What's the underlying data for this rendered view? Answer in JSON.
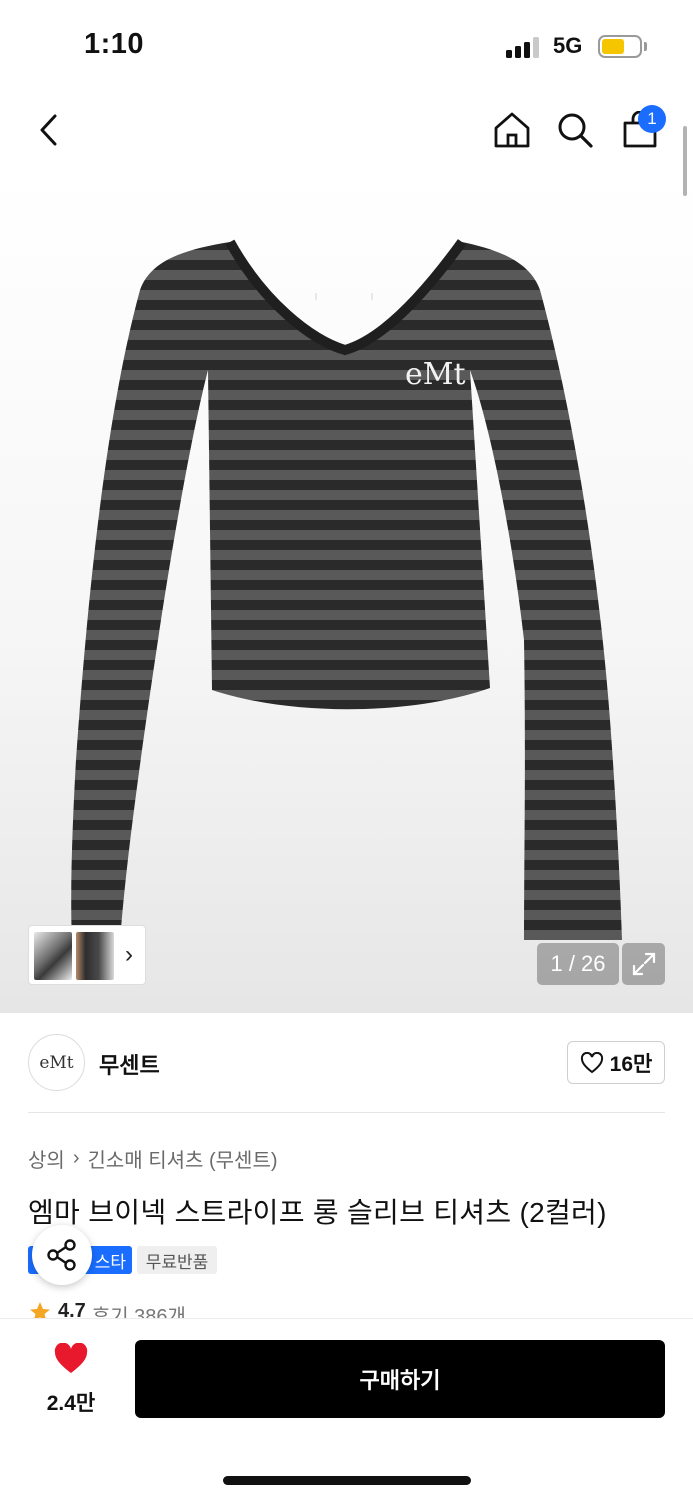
{
  "status_bar": {
    "time": "1:10",
    "network": "5G"
  },
  "nav": {
    "cart_count": "1"
  },
  "gallery": {
    "counter": "1 / 26"
  },
  "brand": {
    "logo_text": "eMt",
    "name": "무센트",
    "likes": "16만"
  },
  "breadcrumb": {
    "category": "상의",
    "subcategory": "긴소매 티셔츠 (무센트)"
  },
  "product": {
    "title": "엠마 브이넥 스트라이프 롱 슬리브 티셔츠 (2컬러)",
    "badges": [
      "스타",
      "무료반품"
    ],
    "rating": "4.7",
    "reviews": "후기 386개"
  },
  "bottom": {
    "wish_count": "2.4만",
    "buy_label": "구매하기"
  },
  "colors": {
    "accent_blue": "#1a6dff",
    "heart_red": "#e8192c",
    "buy_black": "#000000",
    "star": "#f5a623"
  }
}
